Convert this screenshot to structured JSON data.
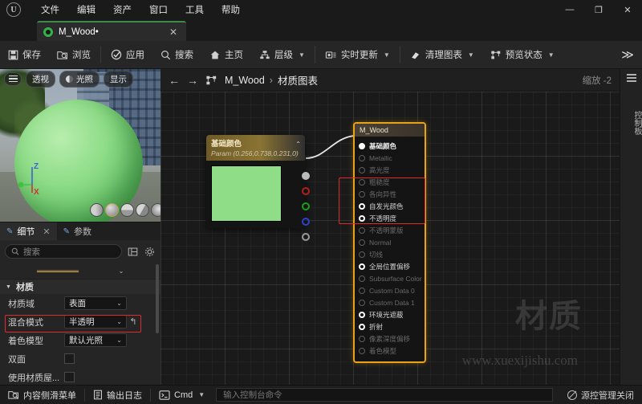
{
  "window": {
    "menu": [
      "文件",
      "编辑",
      "资产",
      "窗口",
      "工具",
      "帮助"
    ],
    "controls": {
      "minimize": "—",
      "maximize": "❐",
      "close": "✕"
    }
  },
  "tab": {
    "label": "M_Wood•",
    "close": "✕",
    "icon": "material-sphere-icon"
  },
  "toolbar": {
    "items": [
      {
        "label": "保存",
        "icon": "save-icon",
        "chevron": false
      },
      {
        "label": "浏览",
        "icon": "browse-icon",
        "chevron": false
      },
      {
        "label": "应用",
        "icon": "apply-check-icon",
        "chevron": false
      },
      {
        "label": "搜索",
        "icon": "search-icon",
        "chevron": false
      },
      {
        "label": "主页",
        "icon": "home-icon",
        "chevron": false
      },
      {
        "label": "层级",
        "icon": "hierarchy-icon",
        "chevron": true
      },
      {
        "label": "实时更新",
        "icon": "live-update-icon",
        "chevron": true
      },
      {
        "label": "清理图表",
        "icon": "clean-graph-icon",
        "chevron": true
      },
      {
        "label": "预览状态",
        "icon": "preview-state-icon",
        "chevron": true
      }
    ],
    "more": "≫"
  },
  "viewport": {
    "overlay_buttons": [
      {
        "label": "透视",
        "icon": "camera-icon"
      },
      {
        "label": "光照",
        "icon": "lit-icon"
      },
      {
        "label": "显示",
        "icon": "show-icon"
      }
    ],
    "axes": {
      "z": "Z",
      "x": "X"
    },
    "shape_buttons": [
      "cylinder-preview",
      "sphere-preview",
      "plane-preview",
      "cube-preview",
      "teapot-preview"
    ]
  },
  "details": {
    "tabs": [
      {
        "label": "细节",
        "active": true,
        "closable": true
      },
      {
        "label": "参数",
        "active": false,
        "closable": false
      }
    ],
    "close_glyph": "✕",
    "search": {
      "placeholder": "搜索",
      "value": ""
    },
    "buttons": [
      "grid-view-icon",
      "settings-gear-icon"
    ],
    "section": {
      "label": "材质",
      "expanded": true
    },
    "properties": [
      {
        "label": "材质域",
        "type": "combo",
        "value": "表面",
        "highlight": false,
        "reset": false
      },
      {
        "label": "混合模式",
        "type": "combo",
        "value": "半透明",
        "highlight": true,
        "reset": true
      },
      {
        "label": "着色模型",
        "type": "combo",
        "value": "默认光照",
        "highlight": false,
        "reset": false
      },
      {
        "label": "双面",
        "type": "checkbox",
        "value": "",
        "highlight": false,
        "reset": false
      },
      {
        "label": "使用材质屋...",
        "type": "checkbox",
        "value": "",
        "highlight": false,
        "reset": false
      }
    ]
  },
  "graph": {
    "nav": {
      "back": "←",
      "forward": "→",
      "icon": "graph-icon"
    },
    "breadcrumb": {
      "root": "M_Wood",
      "separator": "›",
      "current": "材质图表"
    },
    "zoom_label": "缩放 -2",
    "param_node": {
      "title": "基础颜色",
      "subtitle": "Param (0.256,0.738,0.231,0)",
      "collapse_glyph": "⌃",
      "swatch_color": "#8fdd86",
      "pins": [
        "RGBA",
        "R",
        "G",
        "B",
        "A"
      ]
    },
    "material_node": {
      "title": "M_Wood",
      "pins": [
        {
          "label": "基础颜色",
          "state": "connected"
        },
        {
          "label": "Metallic",
          "state": "disabled"
        },
        {
          "label": "高光度",
          "state": "disabled"
        },
        {
          "label": "粗糙度",
          "state": "disabled"
        },
        {
          "label": "各向异性",
          "state": "disabled"
        },
        {
          "label": "自发光颜色",
          "state": "enabled"
        },
        {
          "label": "不透明度",
          "state": "enabled"
        },
        {
          "label": "不透明蒙版",
          "state": "disabled"
        },
        {
          "label": "Normal",
          "state": "disabled"
        },
        {
          "label": "切线",
          "state": "disabled"
        },
        {
          "label": "全局位置偏移",
          "state": "enabled"
        },
        {
          "label": "Subsurface Color",
          "state": "disabled"
        },
        {
          "label": "Custom Data 0",
          "state": "disabled"
        },
        {
          "label": "Custom Data 1",
          "state": "disabled"
        },
        {
          "label": "环境光遮蔽",
          "state": "enabled"
        },
        {
          "label": "折射",
          "state": "enabled"
        },
        {
          "label": "像素深度偏移",
          "state": "disabled"
        },
        {
          "label": "着色模型",
          "state": "disabled"
        }
      ]
    }
  },
  "palette": {
    "label": "控制板",
    "icon": "palette-list-icon"
  },
  "status": {
    "items": [
      {
        "label": "内容侧滑菜单",
        "icon": "content-drawer-icon"
      },
      {
        "label": "输出日志",
        "icon": "output-log-icon"
      },
      {
        "label": "Cmd",
        "icon": "cmd-icon",
        "chevron": true
      }
    ],
    "command": {
      "placeholder": "输入控制台命令",
      "value": ""
    },
    "source_control": {
      "label": "源控管理关闭",
      "icon": "no-entry-icon"
    }
  },
  "watermark": {
    "line1": "材质",
    "line2": "www.xuexijishu.com"
  }
}
